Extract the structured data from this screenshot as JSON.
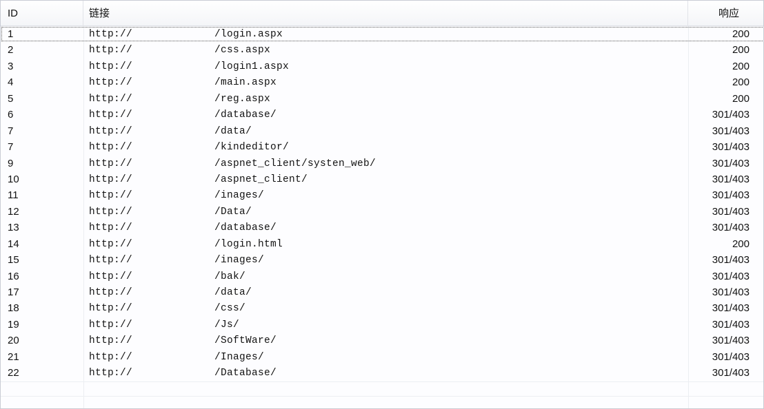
{
  "columns": {
    "id": "ID",
    "link": "链接",
    "response": "响应"
  },
  "scheme": "http://",
  "rows": [
    {
      "id": "1",
      "path": "/login.aspx",
      "status": "200"
    },
    {
      "id": "2",
      "path": "/css.aspx",
      "status": "200"
    },
    {
      "id": "3",
      "path": "/login1.aspx",
      "status": "200"
    },
    {
      "id": "4",
      "path": "/main.aspx",
      "status": "200"
    },
    {
      "id": "5",
      "path": "/reg.aspx",
      "status": "200"
    },
    {
      "id": "6",
      "path": "/database/",
      "status": "301/403"
    },
    {
      "id": "7",
      "path": "/data/",
      "status": "301/403"
    },
    {
      "id": "7",
      "path": "/kindeditor/",
      "status": "301/403"
    },
    {
      "id": "9",
      "path": "/aspnet_client/systen_web/",
      "status": "301/403"
    },
    {
      "id": "10",
      "path": "/aspnet_client/",
      "status": "301/403"
    },
    {
      "id": "11",
      "path": "/inages/",
      "status": "301/403"
    },
    {
      "id": "12",
      "path": "/Data/",
      "status": "301/403"
    },
    {
      "id": "13",
      "path": "/database/",
      "status": "301/403"
    },
    {
      "id": "14",
      "path": "/login.html",
      "status": "200"
    },
    {
      "id": "15",
      "path": "/inages/",
      "status": "301/403"
    },
    {
      "id": "16",
      "path": "/bak/",
      "status": "301/403"
    },
    {
      "id": "17",
      "path": "/data/",
      "status": "301/403"
    },
    {
      "id": "18",
      "path": "/css/",
      "status": "301/403"
    },
    {
      "id": "19",
      "path": "/Js/",
      "status": "301/403"
    },
    {
      "id": "20",
      "path": "/SoftWare/",
      "status": "301/403"
    },
    {
      "id": "21",
      "path": "/Inages/",
      "status": "301/403"
    },
    {
      "id": "22",
      "path": "/Database/",
      "status": "301/403"
    }
  ]
}
